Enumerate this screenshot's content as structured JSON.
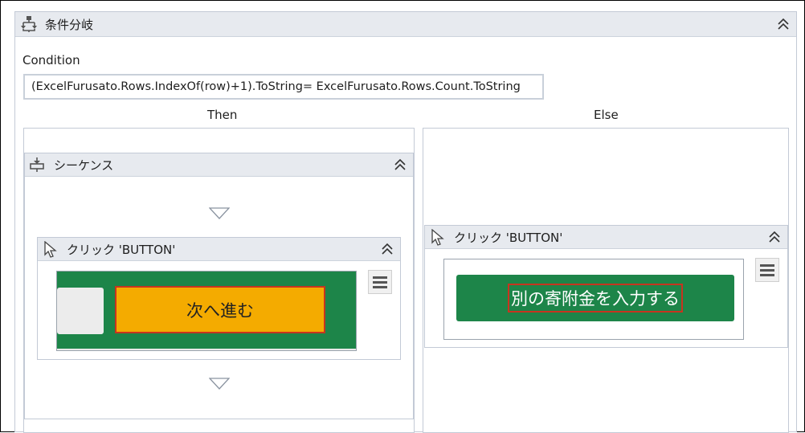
{
  "if_activity": {
    "title": "条件分岐",
    "condition_label": "Condition",
    "condition_value": "(ExcelFurusato.Rows.IndexOf(row)+1).ToString= ExcelFurusato.Rows.Count.ToString",
    "then_label": "Then",
    "else_label": "Else"
  },
  "sequence": {
    "title": "シーケンス"
  },
  "click_then": {
    "title": "クリック 'BUTTON'",
    "preview_button_text": "次へ進む"
  },
  "click_else": {
    "title": "クリック 'BUTTON'",
    "preview_button_text": "別の寄附金を入力する"
  },
  "colors": {
    "preview_green": "#1d8549",
    "button_orange": "#f4ab00",
    "highlight_red": "#c8341f",
    "header_bg": "#e7eaef"
  },
  "icons": [
    "if-activity-icon",
    "sequence-icon",
    "click-cursor-icon",
    "collapse-icon",
    "insert-arrow-icon",
    "menu-icon"
  ]
}
